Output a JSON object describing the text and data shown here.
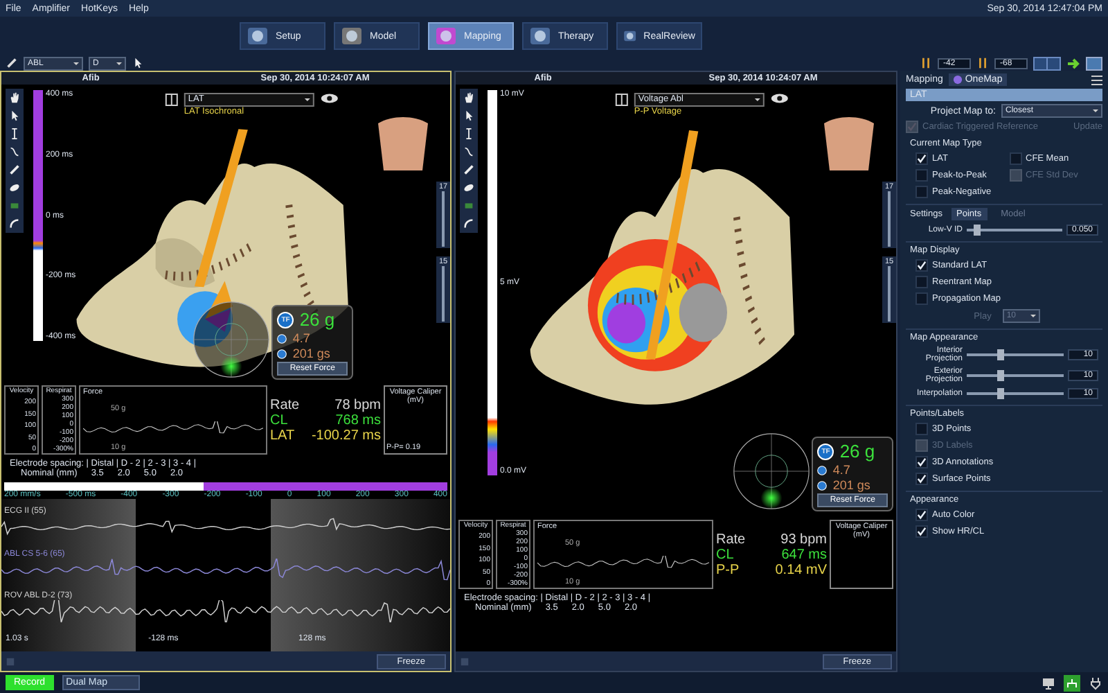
{
  "menu": [
    "File",
    "Amplifier",
    "HotKeys",
    "Help"
  ],
  "clock": "Sep 30, 2014 12:47:04 PM",
  "tabs": [
    {
      "label": "Setup",
      "selected": false
    },
    {
      "label": "Model",
      "selected": false
    },
    {
      "label": "Mapping",
      "selected": true
    },
    {
      "label": "Therapy",
      "selected": false
    },
    {
      "label": "RealReview",
      "selected": false
    }
  ],
  "toolbar": {
    "catheter": "ABL",
    "electrode": "D",
    "gain_a": "-42",
    "gain_b": "-68"
  },
  "viewports": [
    {
      "rhythm": "Afib",
      "timestamp": "Sep 30, 2014 10:24:07 AM",
      "map": "LAT",
      "map_subtitle": "LAT Isochronal",
      "active": true,
      "scale_labels": [
        "400 ms",
        "200 ms",
        "0 ms",
        "-200 ms",
        "-400 ms"
      ],
      "side_sliders": [
        "17",
        "15"
      ],
      "gauges": [
        {
          "title": "Velocity",
          "ticks": [
            "200",
            "150",
            "100",
            "50",
            "0"
          ]
        },
        {
          "title": "Respirat",
          "ticks": [
            "300",
            "200",
            "100",
            "0",
            "-100",
            "-200",
            "-300%"
          ]
        }
      ],
      "force_graph": {
        "title": "Force",
        "upper": "50 g",
        "lower": "10 g"
      },
      "readouts": [
        {
          "label": "Rate",
          "value": "78 bpm",
          "color": "#d8d8d8"
        },
        {
          "label": "CL",
          "value": "768 ms",
          "color": "#3ce03c"
        },
        {
          "label": "LAT",
          "value": "-100.27 ms",
          "color": "#e8d44a"
        }
      ],
      "caliper": {
        "title": "Voltage Caliper (mV)",
        "reading": "P-P= 0.19"
      },
      "contact": {
        "badge": "TF",
        "force": "26 g",
        "index": "4.7",
        "integral": "201 gs",
        "button": "Reset Force"
      },
      "spacing": {
        "label": "Electrode spacing: | Distal | D - 2 | 2 - 3 | 3 - 4 |",
        "nominal_label": "Nominal (mm)",
        "nominal": [
          "3.5",
          "2.0",
          "5.0",
          "2.0"
        ]
      },
      "timeline": {
        "level": 0.45,
        "speed": "200 mm/s",
        "ticks": [
          "-500 ms",
          "-400",
          "-300",
          "-200",
          "-100",
          "0",
          "100",
          "200",
          "300",
          "400"
        ],
        "traces": [
          {
            "label": "ECG II (55)",
            "color": "#d0d0d0"
          },
          {
            "label": "ABL CS 5-6 (65)",
            "color": "#8c88d8"
          },
          {
            "label": "ROV ABL D-2 (73)",
            "color": "#d0d0d0"
          }
        ],
        "duration": "1.03 s",
        "window_start": "-128 ms",
        "window_end": "128 ms"
      },
      "freeze": "Freeze"
    },
    {
      "rhythm": "Afib",
      "timestamp": "Sep 30, 2014 10:24:07 AM",
      "map": "Voltage Abl",
      "map_subtitle": "P-P Voltage",
      "active": false,
      "scale_labels": [
        "10 mV",
        "5 mV",
        "0.0 mV"
      ],
      "side_sliders": [
        "17",
        "15"
      ],
      "gauges": [
        {
          "title": "Velocity",
          "ticks": [
            "200",
            "150",
            "100",
            "50",
            "0"
          ]
        },
        {
          "title": "Respirat",
          "ticks": [
            "300",
            "200",
            "100",
            "0",
            "-100",
            "-200",
            "-300%"
          ]
        }
      ],
      "force_graph": {
        "title": "Force",
        "upper": "50 g",
        "lower": "10 g"
      },
      "readouts": [
        {
          "label": "Rate",
          "value": "93 bpm",
          "color": "#d8d8d8"
        },
        {
          "label": "CL",
          "value": "647 ms",
          "color": "#3ce03c"
        },
        {
          "label": "P-P",
          "value": "0.14 mV",
          "color": "#e8d44a"
        }
      ],
      "caliper": {
        "title": "Voltage Caliper (mV)"
      },
      "contact": {
        "badge": "TF",
        "force": "26 g",
        "index": "4.7",
        "integral": "201 gs",
        "button": "Reset Force"
      },
      "spacing": {
        "label": "Electrode spacing: | Distal | D - 2 | 2 - 3 | 3 - 4 |",
        "nominal_label": "Nominal (mm)",
        "nominal": [
          "3.5",
          "2.0",
          "5.0",
          "2.0"
        ]
      },
      "freeze": "Freeze"
    }
  ],
  "sidebar": {
    "title": "Mapping",
    "tab": "OneMap",
    "maps": [
      {
        "label": "LAT",
        "selected": true
      }
    ],
    "project_label": "Project Map to:",
    "project_value": "Closest",
    "reference": {
      "label": "Cardiac Triggered Reference",
      "checked": true,
      "disabled": true
    },
    "update": "Update",
    "sections": [
      {
        "heading": "Current Map Type",
        "items": [
          {
            "kind": "check",
            "label": "LAT",
            "checked": true,
            "disabled": false
          },
          {
            "kind": "check",
            "label": "CFE Mean",
            "checked": false,
            "disabled": false
          },
          {
            "kind": "check",
            "label": "Peak-to-Peak",
            "checked": false,
            "disabled": false
          },
          {
            "kind": "check",
            "label": "CFE Std Dev",
            "checked": false,
            "disabled": true
          },
          {
            "kind": "check",
            "label": "Peak-Negative",
            "checked": false,
            "disabled": false
          }
        ]
      },
      {
        "heading": "Settings",
        "tabs": [
          {
            "label": "Points",
            "selected": true
          },
          {
            "label": "Model",
            "selected": false
          }
        ],
        "items": [
          {
            "kind": "slider",
            "label": "Low-V ID",
            "level": 0.12,
            "value": "0.050"
          }
        ]
      },
      {
        "heading": "Map Display",
        "items": [
          {
            "kind": "check",
            "label": "Standard LAT",
            "checked": true,
            "disabled": false
          },
          {
            "kind": "check",
            "label": "Reentrant Map",
            "checked": false,
            "disabled": false
          },
          {
            "kind": "check",
            "label": "Propagation Map",
            "checked": false,
            "disabled": false
          },
          {
            "kind": "select",
            "label": "Play",
            "value": "10",
            "disabled": true
          }
        ]
      },
      {
        "heading": "Map Appearance",
        "items": [
          {
            "kind": "slider",
            "label": "Interior Projection",
            "level": 0.35,
            "value": "10"
          },
          {
            "kind": "slider",
            "label": "Exterior Projection",
            "level": 0.35,
            "value": "10"
          },
          {
            "kind": "slider",
            "label": "Interpolation",
            "level": 0.35,
            "value": "10"
          }
        ]
      },
      {
        "heading": "Points/Labels",
        "items": [
          {
            "kind": "check",
            "label": "3D Points",
            "checked": false,
            "disabled": false
          },
          {
            "kind": "check",
            "label": "3D Labels",
            "checked": false,
            "disabled": true
          },
          {
            "kind": "check",
            "label": "3D Annotations",
            "checked": true,
            "disabled": false
          },
          {
            "kind": "check",
            "label": "Surface Points",
            "checked": true,
            "disabled": false
          }
        ]
      },
      {
        "heading": "Appearance",
        "items": [
          {
            "kind": "check",
            "label": "Auto Color",
            "checked": true,
            "disabled": false
          },
          {
            "kind": "check",
            "label": "Show HR/CL",
            "checked": true,
            "disabled": false
          }
        ]
      }
    ]
  },
  "record": "Record",
  "mode_field": "Dual Map"
}
